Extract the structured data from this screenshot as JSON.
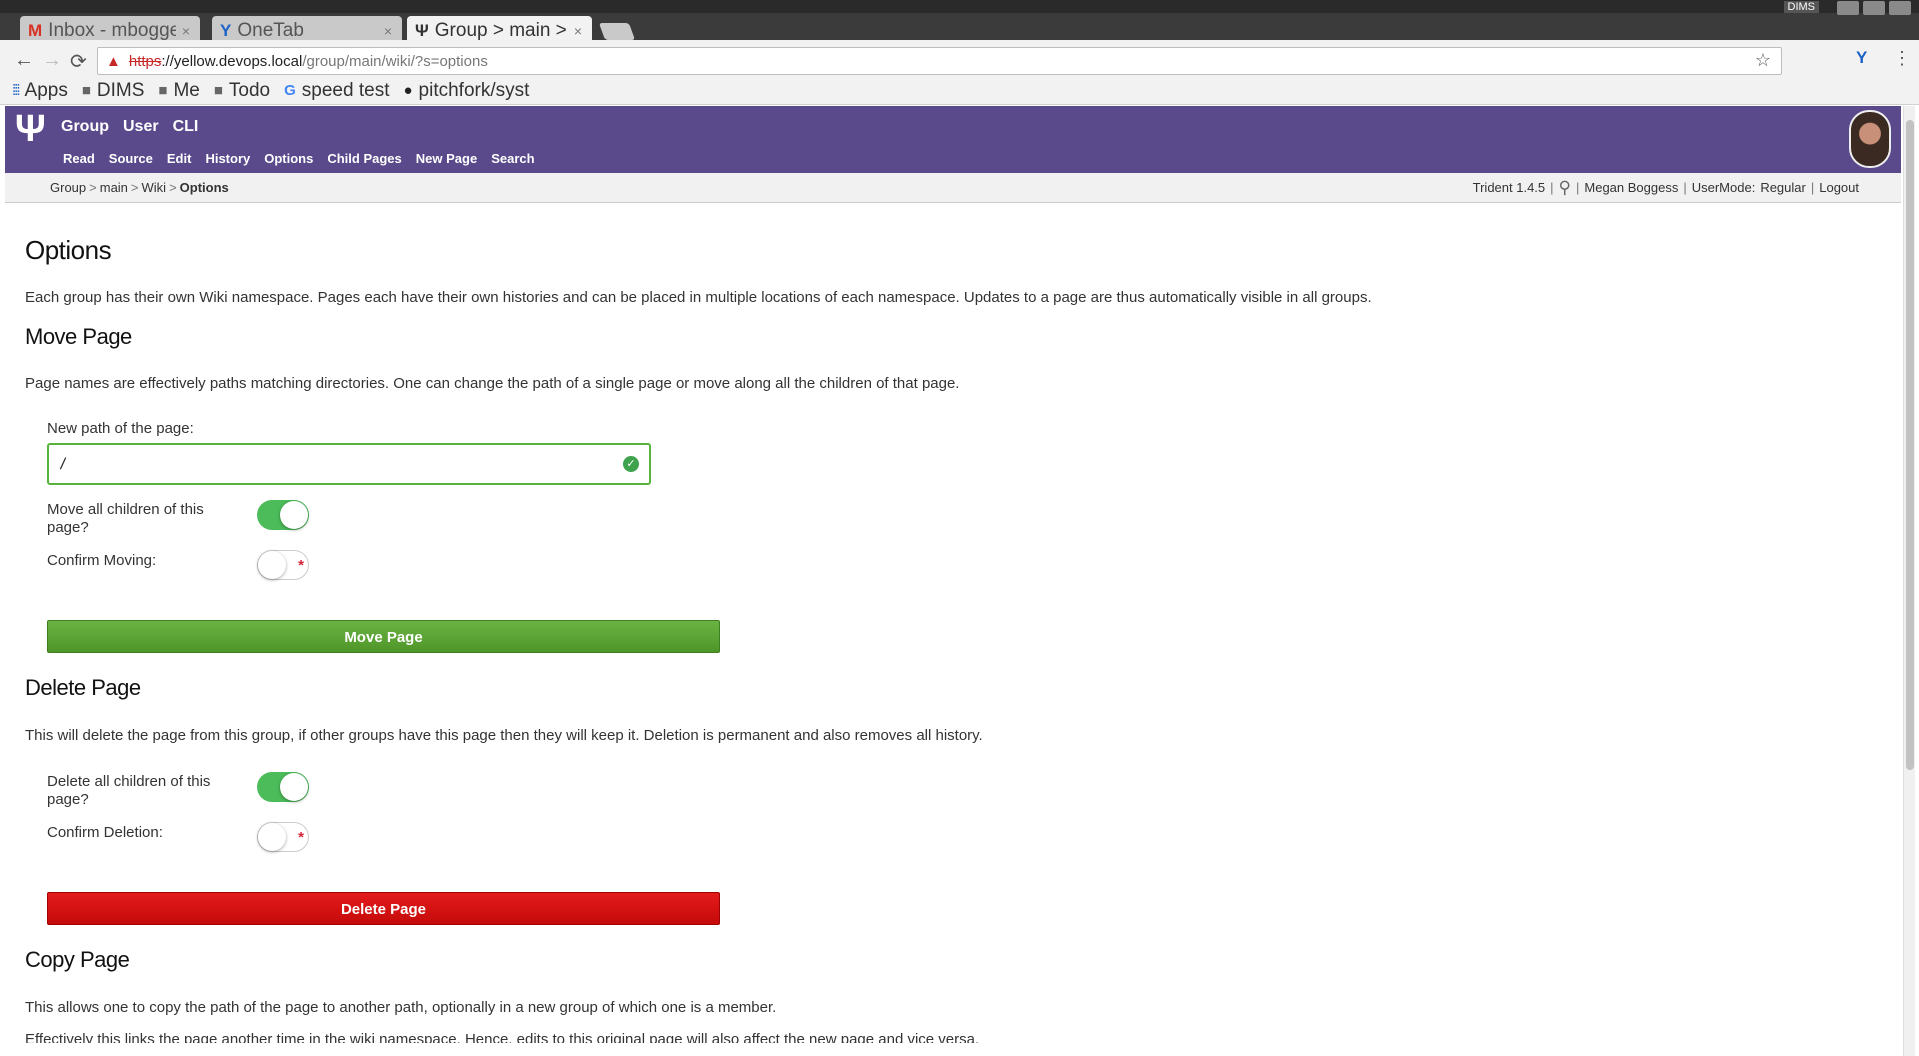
{
  "browser": {
    "tabs": [
      {
        "favicon": "M",
        "title": "Inbox - mbogge",
        "close": "×"
      },
      {
        "favicon": "Y",
        "title": "OneTab",
        "close": "×"
      },
      {
        "favicon": "Ψ",
        "title": "Group > main > W",
        "close": "×"
      }
    ],
    "window_tag": "DIMS",
    "url": {
      "scheme": "https",
      "host": "://yellow.devops.local",
      "path": "/group/main/wiki/?s=options"
    },
    "bookmarks": [
      {
        "icon": "apps-icon",
        "label": "Apps"
      },
      {
        "icon": "folder-icon",
        "label": "DIMS"
      },
      {
        "icon": "folder-icon",
        "label": "Me"
      },
      {
        "icon": "folder-icon",
        "label": "Todo"
      },
      {
        "icon": "google-icon",
        "label": "speed test"
      },
      {
        "icon": "github-icon",
        "label": "pitchfork/syst"
      }
    ]
  },
  "site": {
    "logo": "Ψ",
    "main_nav": [
      "Group",
      "User",
      "CLI"
    ],
    "sub_nav": [
      "Read",
      "Source",
      "Edit",
      "History",
      "Options",
      "Child Pages",
      "New Page",
      "Search"
    ],
    "breadcrumb": [
      "Group",
      "main",
      "Wiki",
      "Options"
    ],
    "version": "Trident 1.4.5",
    "user_name": "Megan Boggess",
    "usermode_label": "UserMode:",
    "usermode_value": "Regular",
    "logout": "Logout"
  },
  "page": {
    "title": "Options",
    "intro": "Each group has their own Wiki namespace. Pages each have their own histories and can be placed in multiple locations of each namespace. Updates to a page are thus automatically visible in all groups.",
    "move": {
      "heading": "Move Page",
      "desc": "Page names are effectively paths matching directories. One can change the path of a single page or move along all the children of that page.",
      "path_label": "New path of the page:",
      "path_value": "/",
      "children_label": "Move all children of this page?",
      "children_on": true,
      "confirm_label": "Confirm Moving:",
      "confirm_on": false,
      "button": "Move Page"
    },
    "delete": {
      "heading": "Delete Page",
      "desc": "This will delete the page from this group, if other groups have this page then they will keep it. Deletion is permanent and also removes all history.",
      "children_label": "Delete all children of this page?",
      "children_on": true,
      "confirm_label": "Confirm Deletion:",
      "confirm_on": false,
      "button": "Delete Page"
    },
    "copy": {
      "heading": "Copy Page",
      "desc": "This allows one to copy the path of the page to another path, optionally in a new group of which one is a member.",
      "desc2": "Effectively this links the page another time in the wiki namespace. Hence, edits to this original page will also affect the new page and vice versa."
    }
  },
  "colors": {
    "header_bg": "#5a4a8c",
    "move_button": "#5aa334",
    "delete_button": "#d41212",
    "toggle_on": "#4cbb5a",
    "input_valid_border": "#57b33e"
  }
}
